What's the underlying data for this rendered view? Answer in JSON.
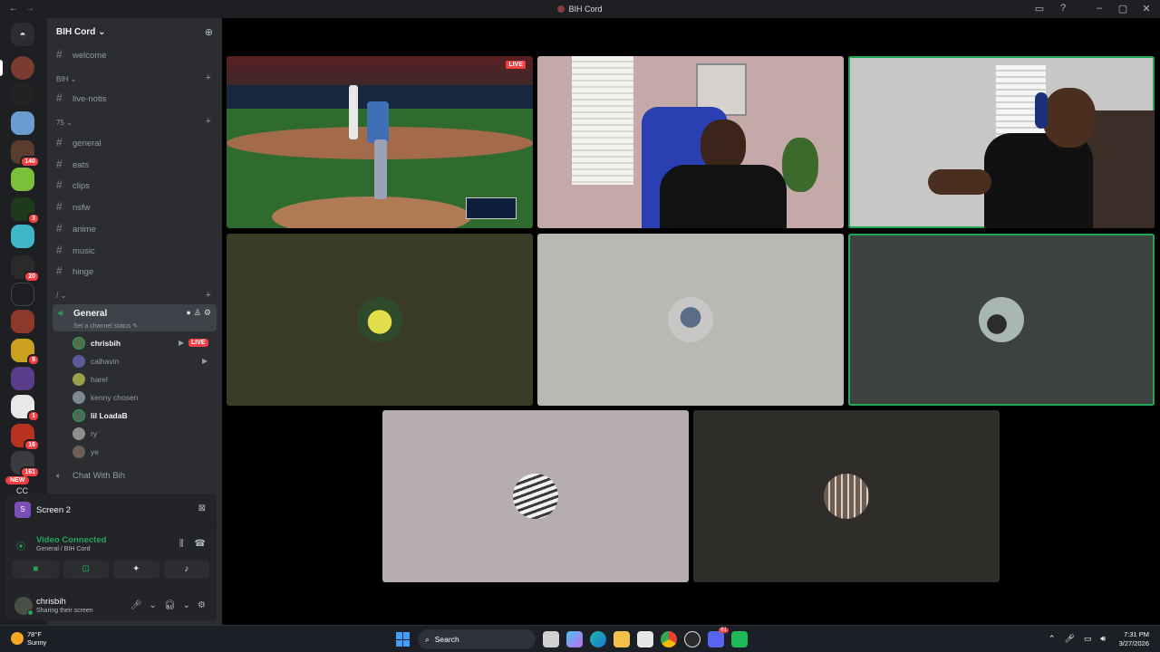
{
  "window": {
    "title": "BIH Cord"
  },
  "server": {
    "name": "BIH Cord"
  },
  "guild_badges": [
    "140",
    "3",
    "20",
    "9",
    "1",
    "16",
    "161"
  ],
  "guild_new_label": "NEW",
  "guild_cc_label": "CC",
  "channels": {
    "top": "welcome",
    "cat1": "BIH",
    "cat1_items": [
      "live-notis"
    ],
    "cat2": "75",
    "cat2_items": [
      "general",
      "eats",
      "clips",
      "nsfw",
      "anime",
      "music",
      "hinge"
    ],
    "cat3": "/",
    "voice_channel": {
      "name": "General",
      "status": "Set a channel status",
      "users": [
        {
          "name": "chrisbih",
          "live": "LIVE",
          "camera": true
        },
        {
          "name": "calhavin",
          "camera": true
        },
        {
          "name": "harel"
        },
        {
          "name": "kenny chosen"
        },
        {
          "name": "lil LoadaB"
        },
        {
          "name": "ry"
        },
        {
          "name": "ye"
        }
      ]
    },
    "voice_channel_2": "Chat With Bih"
  },
  "screen_share": {
    "label": "Screen 2",
    "icon_letter": "S"
  },
  "voice_status": {
    "title": "Video Connected",
    "sub": "General / BIH Cord"
  },
  "user": {
    "name": "chrisbih",
    "status": "Sharing their screen"
  },
  "stream": {
    "live_label": "LIVE"
  },
  "colors": {
    "accent_green": "#23a55a",
    "live_red": "#f23f43",
    "blurple": "#5865f2"
  },
  "taskbar": {
    "temp": "78°F",
    "condition": "Sunny",
    "search": "Search",
    "time": "7:31 PM",
    "date": "3/27/2026",
    "discord_badge": "61"
  }
}
